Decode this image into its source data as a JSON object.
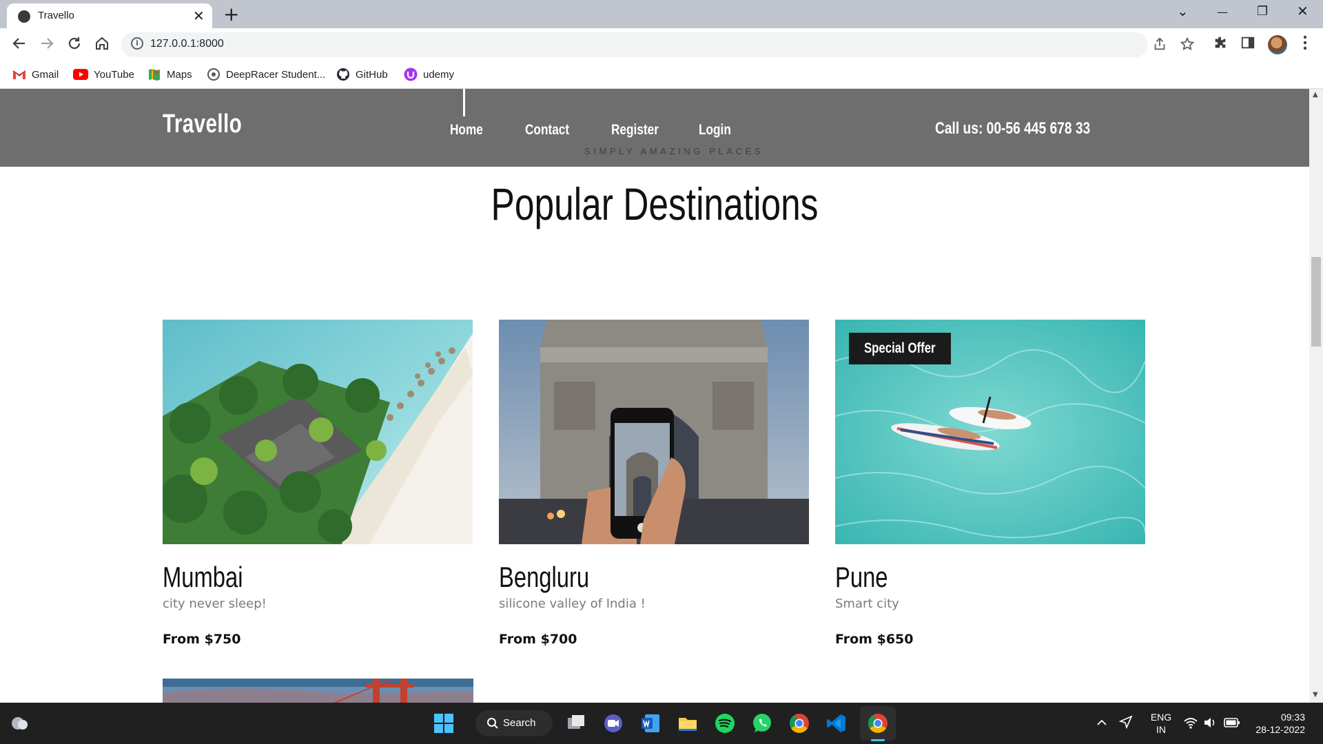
{
  "browser": {
    "tab_title": "Travello",
    "tab_close": "✕",
    "new_tab": "+",
    "url": "127.0.0.1:8000",
    "window_controls": {
      "dropdown": "⌄",
      "minimize": "—",
      "restore": "❐",
      "close": "✕"
    },
    "bookmarks": [
      {
        "label": "Gmail",
        "icon": "gmail-icon",
        "color": "#ea4335"
      },
      {
        "label": "YouTube",
        "icon": "youtube-icon",
        "color": "#ff0000"
      },
      {
        "label": "Maps",
        "icon": "maps-icon",
        "color": "#34a853"
      },
      {
        "label": "DeepRacer Student...",
        "icon": "deepracer-icon",
        "color": "#555555"
      },
      {
        "label": "GitHub",
        "icon": "github-icon",
        "color": "#24292f"
      },
      {
        "label": "udemy",
        "icon": "udemy-icon",
        "color": "#a435f0"
      }
    ]
  },
  "site": {
    "logo": "Travello",
    "nav": [
      "Home",
      "Contact",
      "Register",
      "Login"
    ],
    "tagline": "SIMPLY AMAZING PLACES",
    "call_us": "Call us: 00-56 445 678 33",
    "header_bg": "#6e6e6e",
    "section_title": "Popular Destinations",
    "destinations": [
      {
        "name": "Mumbai",
        "desc": "city never sleep!",
        "price": "From $750",
        "offer": ""
      },
      {
        "name": "Bengluru",
        "desc": "silicone valley of India !",
        "price": "From $700",
        "offer": ""
      },
      {
        "name": "Pune",
        "desc": "Smart city",
        "price": "From $650",
        "offer": "Special Offer"
      }
    ]
  },
  "taskbar": {
    "search_label": "Search",
    "lang_line1": "ENG",
    "lang_line2": "IN",
    "time": "09:33",
    "date": "28-12-2022"
  }
}
